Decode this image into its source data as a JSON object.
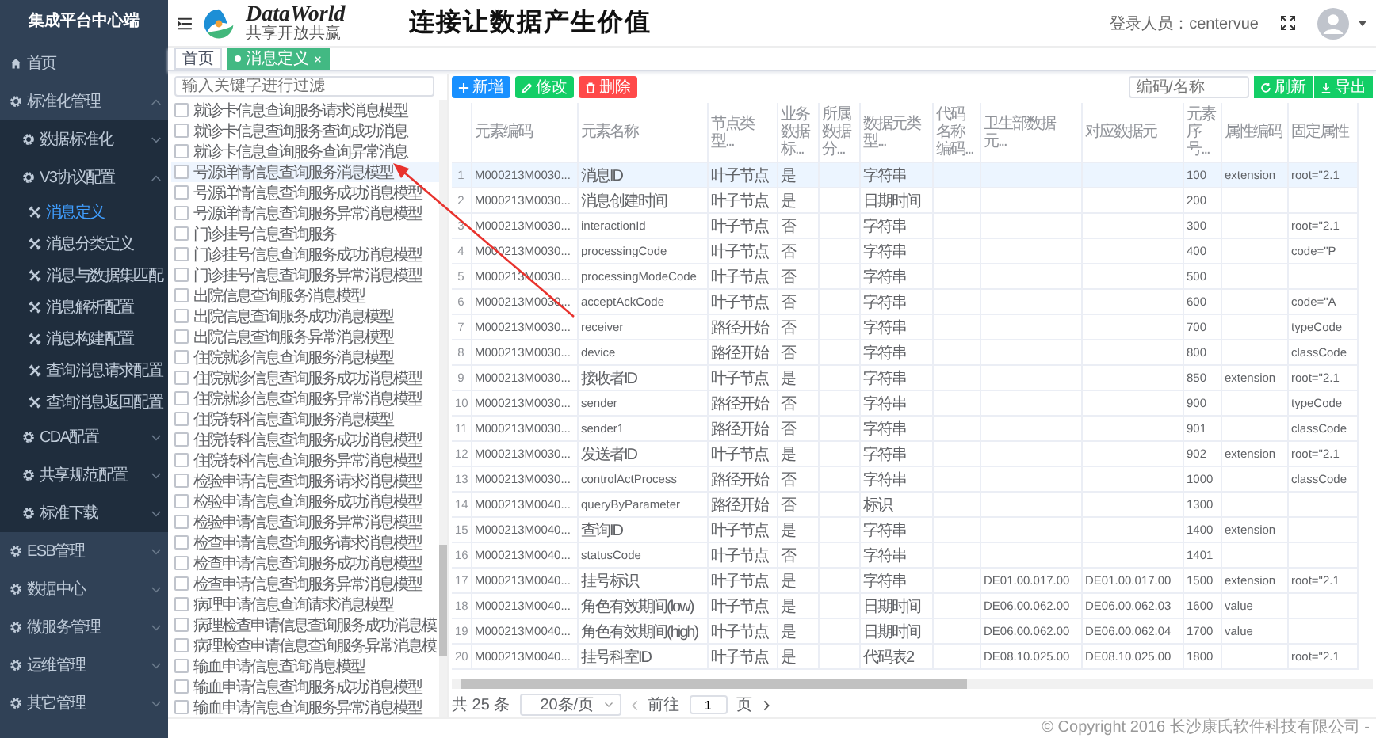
{
  "sidebar": {
    "title": "集成平台中心端",
    "menu": [
      {
        "label": "首页",
        "selected": false
      },
      {
        "label": "标准化管理",
        "expanded": true,
        "children": [
          {
            "label": "数据标准化",
            "expanded": false
          },
          {
            "label": "V3协议配置",
            "expanded": true,
            "children": [
              {
                "label": "消息定义",
                "selected": true
              },
              {
                "label": "消息分类定义",
                "selected": false
              },
              {
                "label": "消息与数据集匹配",
                "selected": false
              },
              {
                "label": "消息解析配置",
                "selected": false
              },
              {
                "label": "消息构建配置",
                "selected": false
              },
              {
                "label": "查询消息请求配置",
                "selected": false
              },
              {
                "label": "查询消息返回配置",
                "selected": false
              }
            ]
          },
          {
            "label": "CDA配置",
            "expanded": false
          },
          {
            "label": "共享规范配置",
            "expanded": false
          },
          {
            "label": "标准下载",
            "expanded": false
          }
        ]
      },
      {
        "label": "ESB管理",
        "expanded": false
      },
      {
        "label": "数据中心",
        "expanded": false
      },
      {
        "label": "微服务管理",
        "expanded": false
      },
      {
        "label": "运维管理",
        "expanded": false
      },
      {
        "label": "其它管理",
        "expanded": false
      }
    ]
  },
  "header": {
    "app_name": "DataWorld",
    "app_tagline": "共享开放共赢",
    "slogan": "连接让数据产生价值",
    "user": "登录人员：centervue"
  },
  "tabs": [
    {
      "label": "首页",
      "selected": false,
      "closable": false
    },
    {
      "label": "消息定义",
      "selected": true,
      "closable": true
    }
  ],
  "tree": {
    "placeholder": "输入关键字进行过滤",
    "items": [
      {
        "label": "就诊卡信息查询服务请求消息模型",
        "checked": false,
        "selected": false
      },
      {
        "label": "就诊卡信息查询服务查询成功消息",
        "checked": false,
        "selected": false
      },
      {
        "label": "就诊卡信息查询服务查询异常消息",
        "checked": false,
        "selected": false
      },
      {
        "label": "号源详情信息查询服务消息模型",
        "checked": false,
        "selected": true
      },
      {
        "label": "号源详情信息查询服务成功消息模型",
        "checked": false,
        "selected": false
      },
      {
        "label": "号源详情信息查询服务异常消息模型",
        "checked": false,
        "selected": false
      },
      {
        "label": "门诊挂号信息查询服务",
        "checked": false,
        "selected": false
      },
      {
        "label": "门诊挂号信息查询服务成功消息模型",
        "checked": false,
        "selected": false
      },
      {
        "label": "门诊挂号信息查询服务异常消息模型",
        "checked": false,
        "selected": false
      },
      {
        "label": "出院信息查询服务消息模型",
        "checked": false,
        "selected": false
      },
      {
        "label": "出院信息查询服务成功消息模型",
        "checked": false,
        "selected": false
      },
      {
        "label": "出院信息查询服务异常消息模型",
        "checked": false,
        "selected": false
      },
      {
        "label": "住院就诊信息查询服务消息模型",
        "checked": false,
        "selected": false
      },
      {
        "label": "住院就诊信息查询服务成功消息模型",
        "checked": false,
        "selected": false
      },
      {
        "label": "住院就诊信息查询服务异常消息模型",
        "checked": false,
        "selected": false
      },
      {
        "label": "住院转科信息查询服务消息模型",
        "checked": false,
        "selected": false
      },
      {
        "label": "住院转科信息查询服务成功消息模型",
        "checked": false,
        "selected": false
      },
      {
        "label": "住院转科信息查询服务异常消息模型",
        "checked": false,
        "selected": false
      },
      {
        "label": "检验申请信息查询服务请求消息模型",
        "checked": false,
        "selected": false
      },
      {
        "label": "检验申请信息查询服务成功消息模型",
        "checked": false,
        "selected": false
      },
      {
        "label": "检验申请信息查询服务异常消息模型",
        "checked": false,
        "selected": false
      },
      {
        "label": "检查申请信息查询服务请求消息模型",
        "checked": false,
        "selected": false
      },
      {
        "label": "检查申请信息查询服务成功消息模型",
        "checked": false,
        "selected": false
      },
      {
        "label": "检查申请信息查询服务异常消息模型",
        "checked": false,
        "selected": false
      },
      {
        "label": "病理申请信息查询请求消息模型",
        "checked": false,
        "selected": false
      },
      {
        "label": "病理检查申请信息查询服务成功消息模",
        "checked": false,
        "selected": false
      },
      {
        "label": "病理检查申请信息查询服务异常消息模",
        "checked": false,
        "selected": false
      },
      {
        "label": "输血申请信息查询消息模型",
        "checked": false,
        "selected": false
      },
      {
        "label": "输血申请信息查询服务成功消息模型",
        "checked": false,
        "selected": false
      },
      {
        "label": "输血申请信息查询服务异常消息模型",
        "checked": false,
        "selected": false
      }
    ]
  },
  "toolbar": {
    "actions": [
      {
        "label": "新增",
        "kind": "add"
      },
      {
        "label": "修改",
        "kind": "edit"
      },
      {
        "label": "删除",
        "kind": "delete"
      }
    ],
    "search_placeholder": "编码/名称",
    "tools": [
      {
        "label": "刷新",
        "kind": "refresh"
      },
      {
        "label": "导出",
        "kind": "export"
      }
    ]
  },
  "table": {
    "columns": [
      "元素编码",
      "元素名称",
      "节点类型...",
      "业务数据标...",
      "所属数据分...",
      "数据元类型...",
      "代码名称编码...",
      "卫生部数据元...",
      "对应数据元",
      "元素序号...",
      "属性编码",
      "固定属性"
    ],
    "rows": [
      {
        "no": "1",
        "selected": true,
        "cells": [
          "M000213M0030...",
          "消息ID",
          "叶子节点",
          "是",
          null,
          "字符串",
          null,
          null,
          null,
          "100",
          "extension",
          "root=\"2.1"
        ]
      },
      {
        "no": "2",
        "selected": false,
        "cells": [
          "M000213M0030...",
          "消息创建时间",
          "叶子节点",
          "是",
          null,
          "日期时间",
          null,
          null,
          null,
          "200",
          null,
          null
        ]
      },
      {
        "no": "3",
        "selected": false,
        "cells": [
          "M000213M0030...",
          "interactionId",
          "叶子节点",
          "否",
          null,
          "字符串",
          null,
          null,
          null,
          "300",
          null,
          "root=\"2.1"
        ]
      },
      {
        "no": "4",
        "selected": false,
        "cells": [
          "M000213M0030...",
          "processingCode",
          "叶子节点",
          "否",
          null,
          "字符串",
          null,
          null,
          null,
          "400",
          null,
          "code=\"P"
        ]
      },
      {
        "no": "5",
        "selected": false,
        "cells": [
          "M000213M0030...",
          "processingModeCode",
          "叶子节点",
          "否",
          null,
          "字符串",
          null,
          null,
          null,
          "500",
          null,
          null
        ]
      },
      {
        "no": "6",
        "selected": false,
        "cells": [
          "M000213M0030...",
          "acceptAckCode",
          "叶子节点",
          "否",
          null,
          "字符串",
          null,
          null,
          null,
          "600",
          null,
          "code=\"A"
        ]
      },
      {
        "no": "7",
        "selected": false,
        "cells": [
          "M000213M0030...",
          "receiver",
          "路径开始",
          "否",
          null,
          "字符串",
          null,
          null,
          null,
          "700",
          null,
          "typeCode"
        ]
      },
      {
        "no": "8",
        "selected": false,
        "cells": [
          "M000213M0030...",
          "device",
          "路径开始",
          "否",
          null,
          "字符串",
          null,
          null,
          null,
          "800",
          null,
          "classCode"
        ]
      },
      {
        "no": "9",
        "selected": false,
        "cells": [
          "M000213M0030...",
          "接收者ID",
          "叶子节点",
          "是",
          null,
          "字符串",
          null,
          null,
          null,
          "850",
          "extension",
          "root=\"2.1"
        ]
      },
      {
        "no": "10",
        "selected": false,
        "cells": [
          "M000213M0030...",
          "sender",
          "路径开始",
          "否",
          null,
          "字符串",
          null,
          null,
          null,
          "900",
          null,
          "typeCode"
        ]
      },
      {
        "no": "11",
        "selected": false,
        "cells": [
          "M000213M0030...",
          "sender1",
          "路径开始",
          "否",
          null,
          "字符串",
          null,
          null,
          null,
          "901",
          null,
          "classCode"
        ]
      },
      {
        "no": "12",
        "selected": false,
        "cells": [
          "M000213M0030...",
          "发送者ID",
          "叶子节点",
          "是",
          null,
          "字符串",
          null,
          null,
          null,
          "902",
          "extension",
          "root=\"2.1"
        ]
      },
      {
        "no": "13",
        "selected": false,
        "cells": [
          "M000213M0030...",
          "controlActProcess",
          "路径开始",
          "否",
          null,
          "字符串",
          null,
          null,
          null,
          "1000",
          null,
          "classCode"
        ]
      },
      {
        "no": "14",
        "selected": false,
        "cells": [
          "M000213M0040...",
          "queryByParameter",
          "路径开始",
          "否",
          null,
          "标识",
          null,
          null,
          null,
          "1300",
          null,
          null
        ]
      },
      {
        "no": "15",
        "selected": false,
        "cells": [
          "M000213M0040...",
          "查询ID",
          "叶子节点",
          "是",
          null,
          "字符串",
          null,
          null,
          null,
          "1400",
          "extension",
          null
        ]
      },
      {
        "no": "16",
        "selected": false,
        "cells": [
          "M000213M0040...",
          "statusCode",
          "叶子节点",
          "否",
          null,
          "字符串",
          null,
          null,
          null,
          "1401",
          null,
          null
        ]
      },
      {
        "no": "17",
        "selected": false,
        "cells": [
          "M000213M0040...",
          "挂号标识",
          "叶子节点",
          "是",
          null,
          "字符串",
          null,
          "DE01.00.017.00",
          "DE01.00.017.00",
          "1500",
          "extension",
          "root=\"2.1"
        ]
      },
      {
        "no": "18",
        "selected": false,
        "cells": [
          "M000213M0040...",
          "角色有效期间(low)",
          "叶子节点",
          "是",
          null,
          "日期时间",
          null,
          "DE06.00.062.00",
          "DE06.00.062.03",
          "1600",
          "value",
          null
        ]
      },
      {
        "no": "19",
        "selected": false,
        "cells": [
          "M000213M0040...",
          "角色有效期间(high)",
          "叶子节点",
          "是",
          null,
          "日期时间",
          null,
          "DE06.00.062.00",
          "DE06.00.062.04",
          "1700",
          "value",
          null
        ]
      },
      {
        "no": "20",
        "selected": false,
        "cells": [
          "M000213M0040...",
          "挂号科室ID",
          "叶子节点",
          "是",
          null,
          "代码表2",
          null,
          "DE08.10.025.00",
          "DE08.10.025.00",
          "1800",
          null,
          "root=\"2.1"
        ]
      }
    ]
  },
  "pagination": {
    "total": "共 25 条",
    "page_size": "20条/页",
    "goto_label": "前往",
    "page": "1",
    "page_suffix": "页"
  },
  "footer": "© Copyright 2016 长沙康氏软件科技有限公司 -"
}
